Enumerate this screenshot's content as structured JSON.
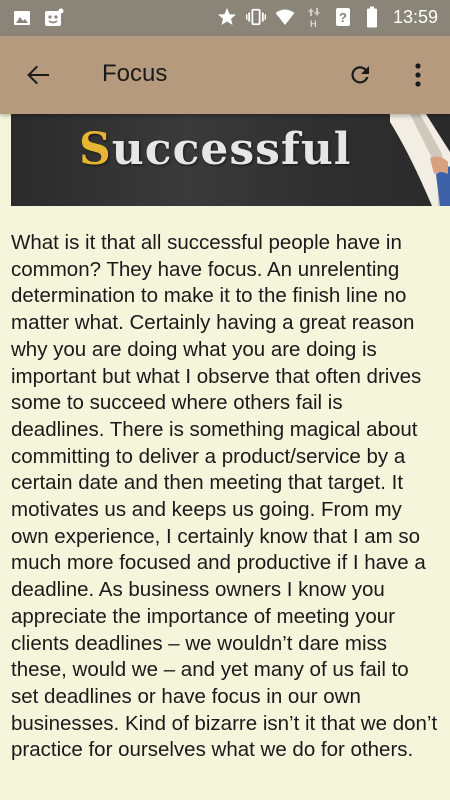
{
  "status_bar": {
    "time": "13:59",
    "left_icons": [
      "image-icon",
      "face-notification-icon"
    ],
    "right_icons": [
      "star-icon",
      "vibrate-icon",
      "wifi-icon",
      "data-transfer-icon",
      "signal-unknown-icon",
      "battery-icon"
    ]
  },
  "app_bar": {
    "title": "Focus",
    "background": "#b59a7d"
  },
  "hero": {
    "word_first_letter": "S",
    "word_rest": "uccessful",
    "first_letter_color": "#e6b531"
  },
  "article": {
    "text": "What is it that all successful people have in common?  They have focus.  An unrelenting determination to make it to the finish line no matter what.  Certainly having a great reason why you are doing what you are doing is important but what I observe that often drives some to succeed where others fail is deadlines.  There is something magical about committing to deliver a product/service by a certain date and then meeting that target.  It motivates us and keeps us going.  From my own experience, I certainly know that I am so much more focused and productive if I have a deadline.  As business owners I know you appreciate the importance of meeting your clients deadlines – we wouldn’t dare miss these, would we – and yet many of us fail to set deadlines or have focus in our own businesses.  Kind of bizarre isn’t it that we don’t practice for ourselves what we do for others."
  },
  "colors": {
    "status_bar": "#8a8479",
    "page_background": "#f5f5dc"
  }
}
